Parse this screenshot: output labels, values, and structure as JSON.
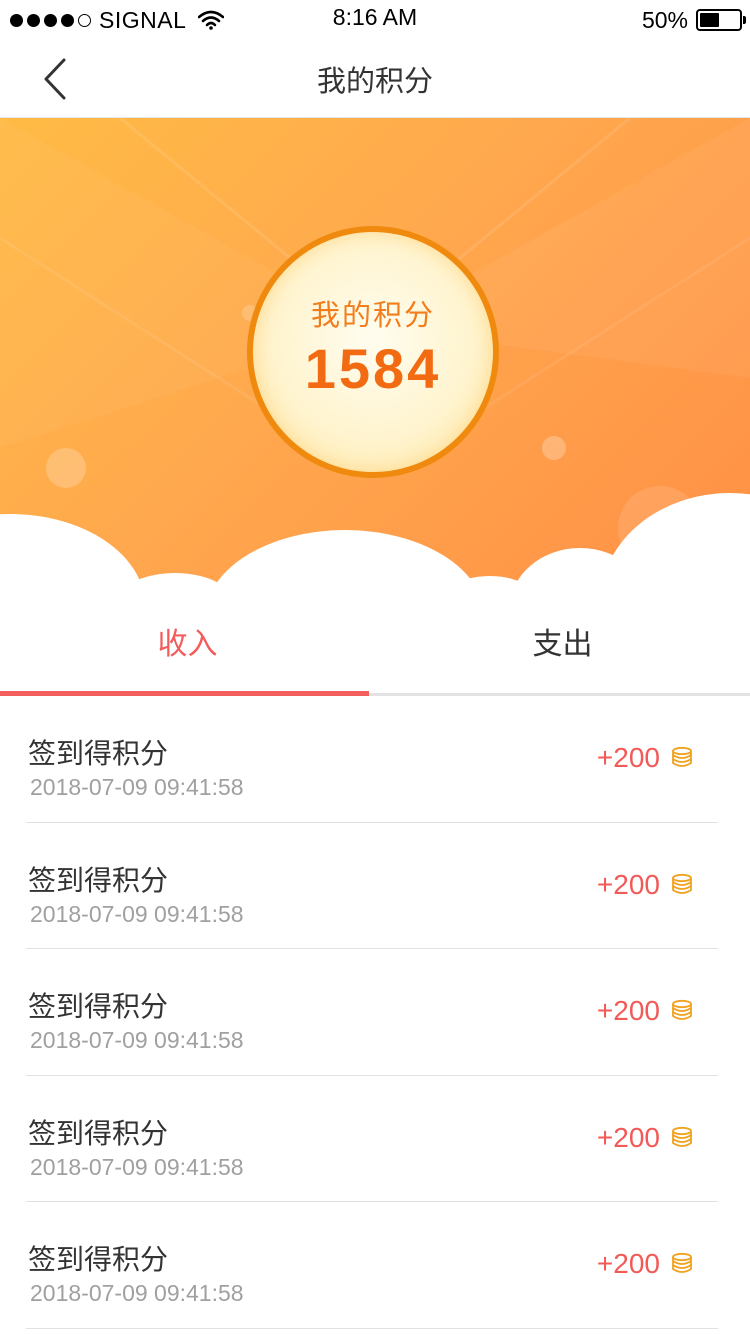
{
  "status_bar": {
    "carrier": "SIGNAL",
    "time": "8:16 AM",
    "battery": "50%",
    "battery_level": 0.5
  },
  "nav": {
    "title": "我的积分",
    "back_icon": "chevron-left-icon"
  },
  "header": {
    "points_label": "我的积分",
    "points_value": "1584",
    "gradient_colors": [
      "#ffbb45",
      "#ff8f45"
    ],
    "ring_color": "#f08a0e"
  },
  "tabs": [
    {
      "label": "收入",
      "active": true
    },
    {
      "label": "支出",
      "active": false
    }
  ],
  "accent_color": "#f2605e",
  "records": [
    {
      "title": "签到得积分",
      "time": "2018-07-09 09:41:58",
      "amount": "+200",
      "icon": "coin-stack-icon"
    },
    {
      "title": "签到得积分",
      "time": "2018-07-09 09:41:58",
      "amount": "+200",
      "icon": "coin-stack-icon"
    },
    {
      "title": "签到得积分",
      "time": "2018-07-09 09:41:58",
      "amount": "+200",
      "icon": "coin-stack-icon"
    },
    {
      "title": "签到得积分",
      "time": "2018-07-09 09:41:58",
      "amount": "+200",
      "icon": "coin-stack-icon"
    },
    {
      "title": "签到得积分",
      "time": "2018-07-09 09:41:58",
      "amount": "+200",
      "icon": "coin-stack-icon"
    }
  ]
}
